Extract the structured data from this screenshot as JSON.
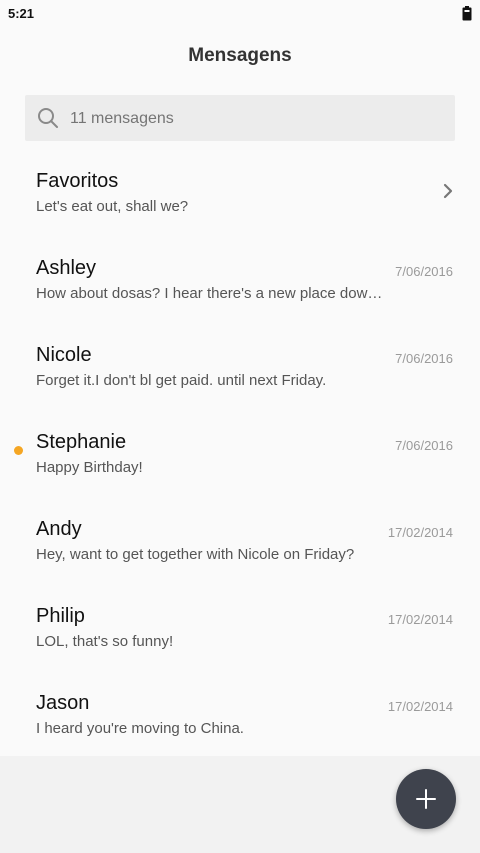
{
  "status_bar": {
    "time": "5:21"
  },
  "header": {
    "title": "Mensagens"
  },
  "search": {
    "placeholder": "11 mensagens"
  },
  "messages": [
    {
      "name": "Favoritos",
      "preview": "Let's eat out, shall we?",
      "date": "",
      "has_chevron": true,
      "unread": false
    },
    {
      "name": "Ashley",
      "preview": "How about dosas? I hear there's a new place down the street",
      "date": "7/06/2016",
      "unread": false
    },
    {
      "name": "Nicole",
      "preview": "Forget it.I don't bl get paid. until next Friday.",
      "date": "7/06/2016",
      "unread": false
    },
    {
      "name": "Stephanie",
      "preview": "Happy Birthday!",
      "date": "7/06/2016",
      "unread": true
    },
    {
      "name": "Andy",
      "preview": "Hey, want to get together with Nicole on Friday?",
      "date": "17/02/2014",
      "unread": false
    },
    {
      "name": "Philip",
      "preview": "LOL, that's so funny!",
      "date": "17/02/2014",
      "unread": false
    },
    {
      "name": "Jason",
      "preview": "I heard you're moving to China.",
      "date": "17/02/2014",
      "unread": false
    }
  ],
  "colors": {
    "unread_dot": "#f5a623",
    "fab_background": "#3f434d"
  },
  "icons": {
    "search": "search-icon",
    "chevron": "chevron-right-icon",
    "fab": "plus-icon",
    "battery": "battery-icon"
  }
}
